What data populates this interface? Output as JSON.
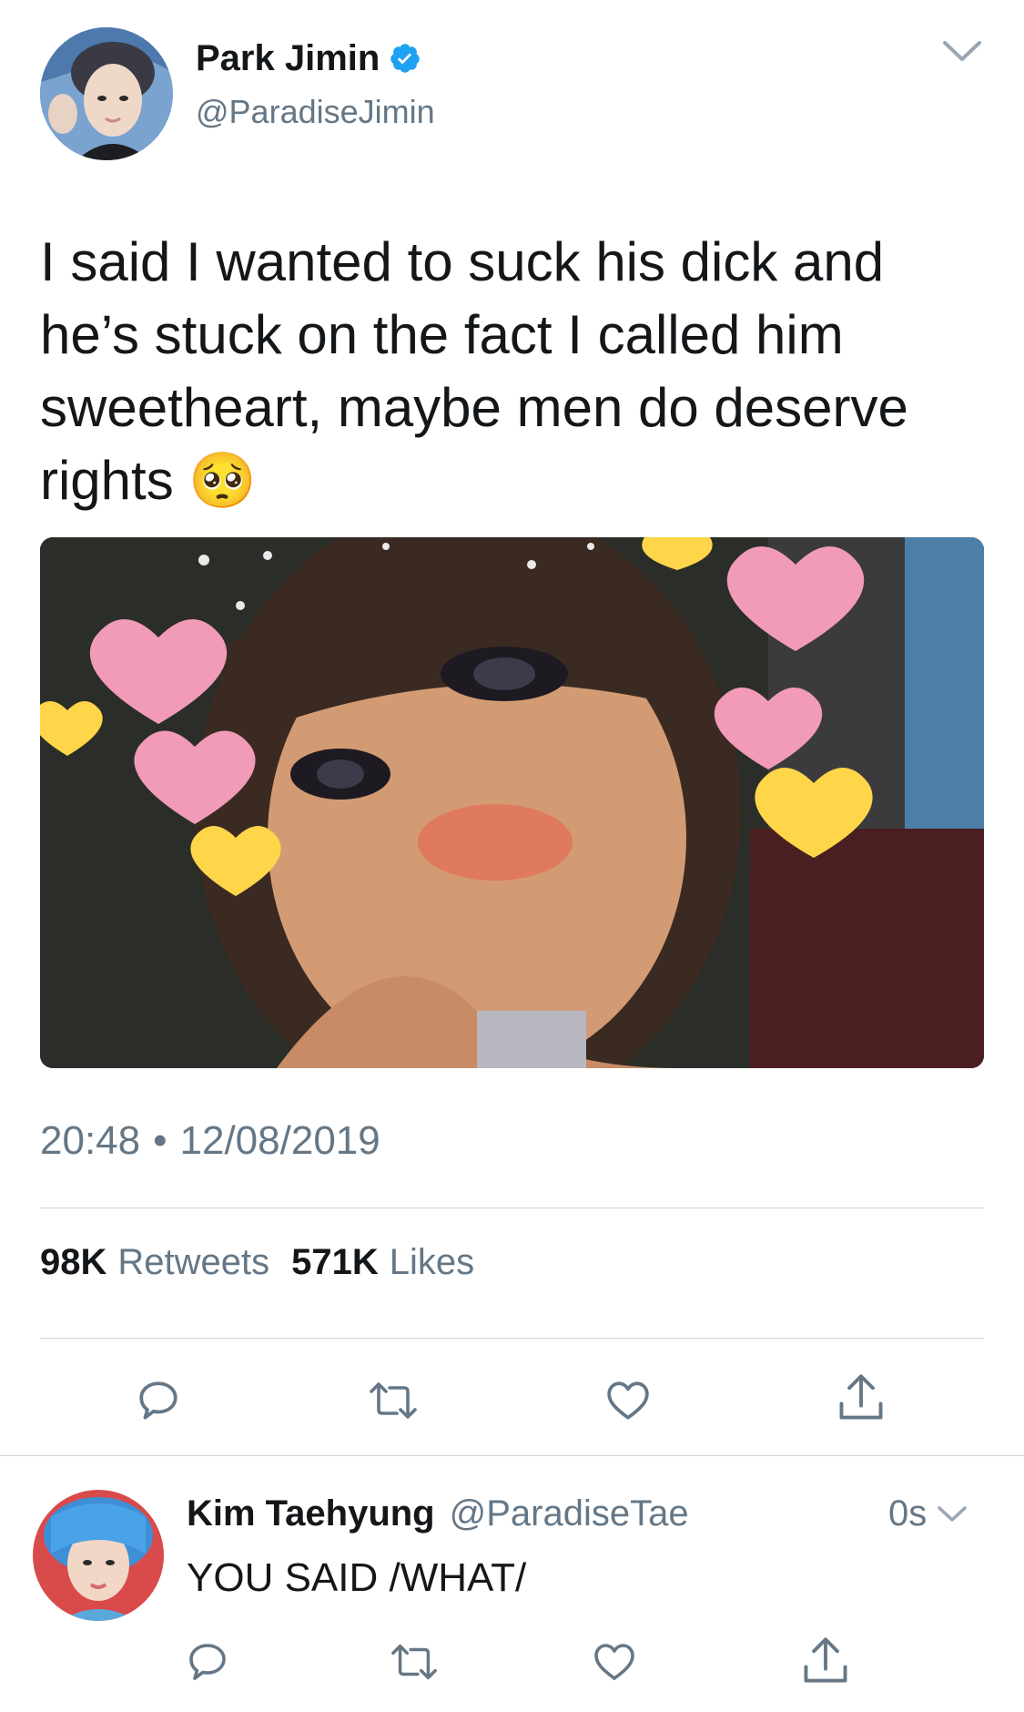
{
  "tweet": {
    "author_name": "Park Jimin",
    "handle": "@ParadiseJimin",
    "text": "I said I wanted to suck his dick and he’s stuck on the fact I called him sweetheart, maybe men do deserve rights 🥺",
    "time": "20:48",
    "separator": "•",
    "date": "12/08/2019",
    "retweets_count": "98K",
    "retweets_label": "Retweets",
    "likes_count": "571K",
    "likes_label": "Likes"
  },
  "reply": {
    "author_name": "Kim Taehyung",
    "handle": "@ParadiseTae",
    "time": "0s",
    "text": "YOU SAID /WHAT/"
  },
  "icons": {
    "verified": "verified-badge-icon",
    "chevron": "chevron-down-icon",
    "reply": "reply-icon",
    "retweet": "retweet-icon",
    "like": "heart-icon",
    "share": "share-icon"
  },
  "colors": {
    "verified_blue": "#1da1f2",
    "text": "#14171a",
    "muted": "#657786",
    "divider": "#cfd6dc"
  }
}
